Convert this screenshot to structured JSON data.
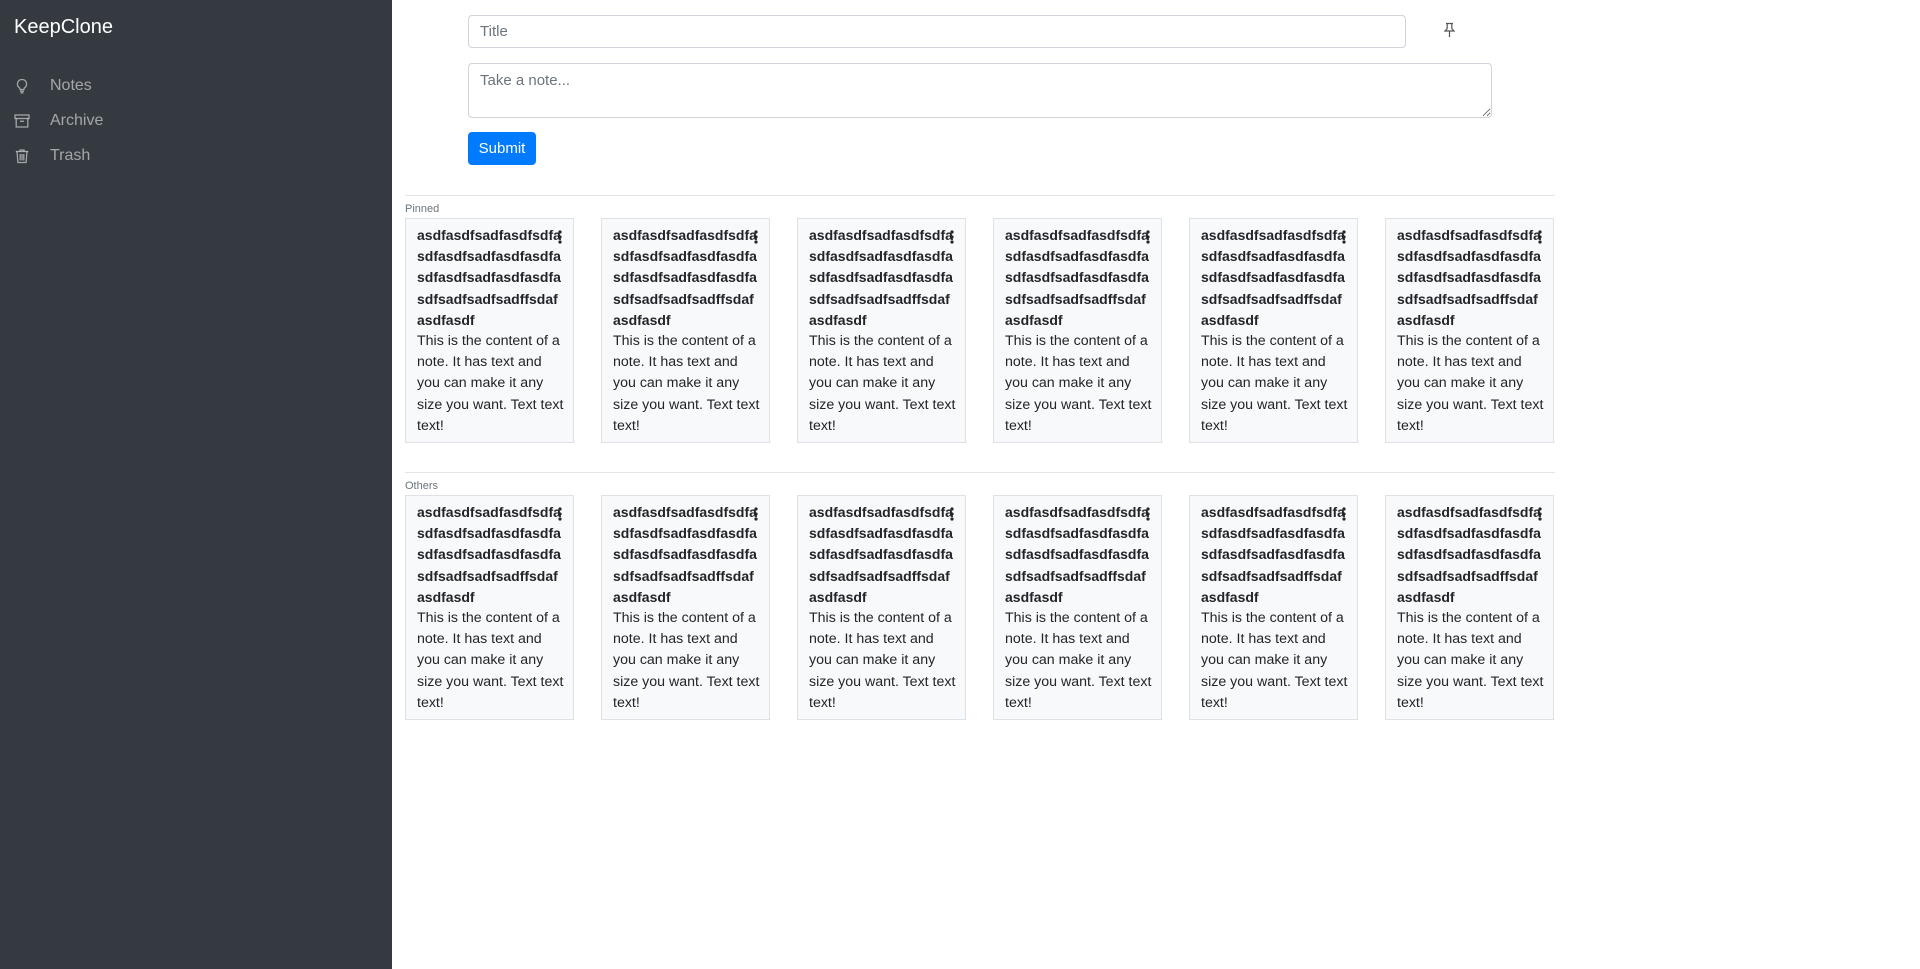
{
  "app": {
    "brand": "KeepClone"
  },
  "sidebar": {
    "items": [
      {
        "label": "Notes",
        "icon": "lightbulb-icon"
      },
      {
        "label": "Archive",
        "icon": "archive-icon"
      },
      {
        "label": "Trash",
        "icon": "trash-icon"
      }
    ]
  },
  "composer": {
    "title_placeholder": "Title",
    "note_placeholder": "Take a note...",
    "submit_label": "Submit",
    "pin_icon": "pin-icon"
  },
  "sections": {
    "pinned": {
      "label": "Pinned",
      "notes": [
        {
          "title": "asdfasdfsadfasdfsdfasdfasdfsadfasdfasdfasdfasdfsadfasdfasdfasdfsadfsadfsadffsdafasdfasdf",
          "content": "This is the content of a note. It has text and you can make it any size you want. Text text text!"
        },
        {
          "title": "asdfasdfsadfasdfsdfasdfasdfsadfasdfasdfasdfasdfsadfasdfasdfasdfsadfsadfsadffsdafasdfasdf",
          "content": "This is the content of a note. It has text and you can make it any size you want. Text text text!"
        },
        {
          "title": "asdfasdfsadfasdfsdfasdfasdfsadfasdfasdfasdfasdfsadfasdfasdfasdfsadfsadfsadffsdafasdfasdf",
          "content": "This is the content of a note. It has text and you can make it any size you want. Text text text!"
        },
        {
          "title": "asdfasdfsadfasdfsdfasdfasdfsadfasdfasdfasdfasdfsadfasdfasdfasdfsadfsadfsadffsdafasdfasdf",
          "content": "This is the content of a note. It has text and you can make it any size you want. Text text text!"
        },
        {
          "title": "asdfasdfsadfasdfsdfasdfasdfsadfasdfasdfasdfasdfsadfasdfasdfasdfsadfsadfsadffsdafasdfasdf",
          "content": "This is the content of a note. It has text and you can make it any size you want. Text text text!"
        },
        {
          "title": "asdfasdfsadfasdfsdfasdfasdfsadfasdfasdfasdfasdfsadfasdfasdfasdfsadfsadfsadffsdafasdfasdf",
          "content": "This is the content of a note. It has text and you can make it any size you want. Text text text!"
        }
      ]
    },
    "others": {
      "label": "Others",
      "notes": [
        {
          "title": "asdfasdfsadfasdfsdfasdfasdfsadfasdfasdfasdfasdfsadfasdfasdfasdfsadfsadfsadffsdafasdfasdf",
          "content": "This is the content of a note. It has text and you can make it any size you want. Text text text!"
        },
        {
          "title": "asdfasdfsadfasdfsdfasdfasdfsadfasdfasdfasdfasdfsadfasdfasdfasdfsadfsadfsadffsdafasdfasdf",
          "content": "This is the content of a note. It has text and you can make it any size you want. Text text text!"
        },
        {
          "title": "asdfasdfsadfasdfsdfasdfasdfsadfasdfasdfasdfasdfsadfasdfasdfasdfsadfsadfsadffsdafasdfasdf",
          "content": "This is the content of a note. It has text and you can make it any size you want. Text text text!"
        },
        {
          "title": "asdfasdfsadfasdfsdfasdfasdfsadfasdfasdfasdfasdfsadfasdfasdfasdfsadfsadfsadffsdafasdfasdf",
          "content": "This is the content of a note. It has text and you can make it any size you want. Text text text!"
        },
        {
          "title": "asdfasdfsadfasdfsdfasdfasdfsadfasdfasdfasdfasdfsadfasdfasdfasdfsadfsadfsadffsdafasdfasdf",
          "content": "This is the content of a note. It has text and you can make it any size you want. Text text text!"
        },
        {
          "title": "asdfasdfsadfasdfsdfasdfasdfsadfasdfasdfasdfasdfsadfasdfasdfasdfsadfsadfsadffsdafasdfasdf",
          "content": "This is the content of a note. It has text and you can make it any size you want. Text text text!"
        }
      ]
    }
  },
  "colors": {
    "sidebar_bg": "#343a40",
    "primary": "#007bff",
    "card_bg": "#f8f9fa"
  }
}
